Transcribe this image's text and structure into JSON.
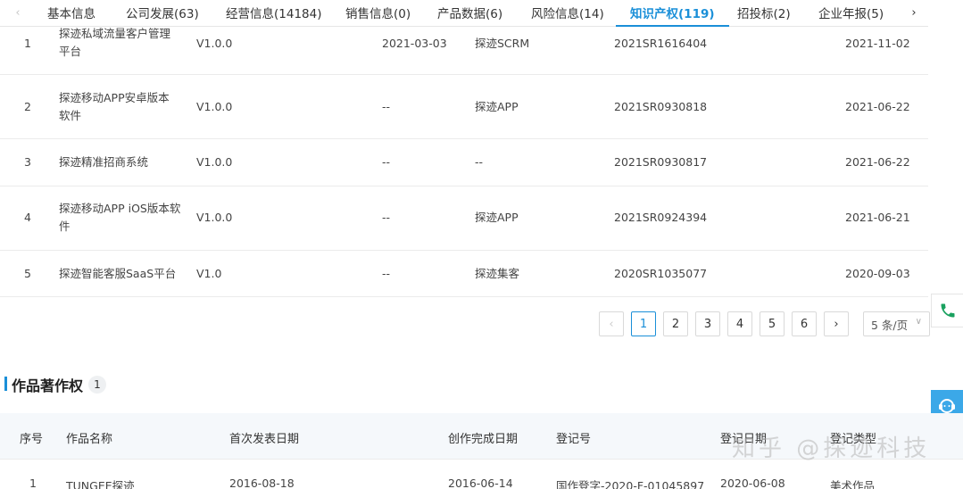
{
  "tabs": {
    "items": [
      {
        "label": "基本信息",
        "active": false
      },
      {
        "label": "公司发展(63)",
        "active": false
      },
      {
        "label": "经营信息(14184)",
        "active": false
      },
      {
        "label": "销售信息(0)",
        "active": false
      },
      {
        "label": "产品数据(6)",
        "active": false
      },
      {
        "label": "风险信息(14)",
        "active": false
      },
      {
        "label": "知识产权(119)",
        "active": true
      },
      {
        "label": "招投标(2)",
        "active": false
      },
      {
        "label": "企业年报(5)",
        "active": false
      }
    ],
    "prev_icon": "‹",
    "next_icon": "›"
  },
  "software_rows": [
    {
      "idx": "1",
      "name_line1": "探迹私域流量客户管理",
      "name_line2": "平台",
      "version": "V1.0.0",
      "publish_date": "2021-03-03",
      "short_name": "探迹SCRM",
      "reg_no": "2021SR1616404",
      "reg_date": "2021-11-02"
    },
    {
      "idx": "2",
      "name_line1": "探迹移动APP安卓版本",
      "name_line2": "软件",
      "version": "V1.0.0",
      "publish_date": "--",
      "short_name": "探迹APP",
      "reg_no": "2021SR0930818",
      "reg_date": "2021-06-22"
    },
    {
      "idx": "3",
      "name_line1": "探迹精准招商系统",
      "name_line2": "",
      "version": "V1.0.0",
      "publish_date": "--",
      "short_name": "--",
      "reg_no": "2021SR0930817",
      "reg_date": "2021-06-22"
    },
    {
      "idx": "4",
      "name_line1": "探迹移动APP iOS版本软",
      "name_line2": "件",
      "version": "V1.0.0",
      "publish_date": "--",
      "short_name": "探迹APP",
      "reg_no": "2021SR0924394",
      "reg_date": "2021-06-21"
    },
    {
      "idx": "5",
      "name_line1": "探迹智能客服SaaS平台",
      "name_line2": "",
      "version": "V1.0",
      "publish_date": "--",
      "short_name": "探迹集客",
      "reg_no": "2020SR1035077",
      "reg_date": "2020-09-03"
    }
  ],
  "pagination": {
    "prev": "‹",
    "next": "›",
    "pages": [
      "1",
      "2",
      "3",
      "4",
      "5",
      "6"
    ],
    "current": "1",
    "page_size": "5 条/页",
    "page_size_chevron": "∨"
  },
  "works_section": {
    "title": "作品著作权",
    "count": "1",
    "headers": [
      "序号",
      "作品名称",
      "首次发表日期",
      "创作完成日期",
      "登记号",
      "登记日期",
      "登记类型"
    ],
    "rows": [
      {
        "idx": "1",
        "name": "TUNGEE探迹",
        "first_pub": "2016-08-18",
        "completed": "2016-06-14",
        "reg_no": "国作登字-2020-F-01045897",
        "reg_date": "2020-06-08",
        "type": "美术作品"
      }
    ]
  },
  "side": {
    "phone_icon": "phone-icon",
    "help_icon": "customer-service-icon",
    "top_icon": "^"
  },
  "watermark": "知乎 @探迹科技"
}
